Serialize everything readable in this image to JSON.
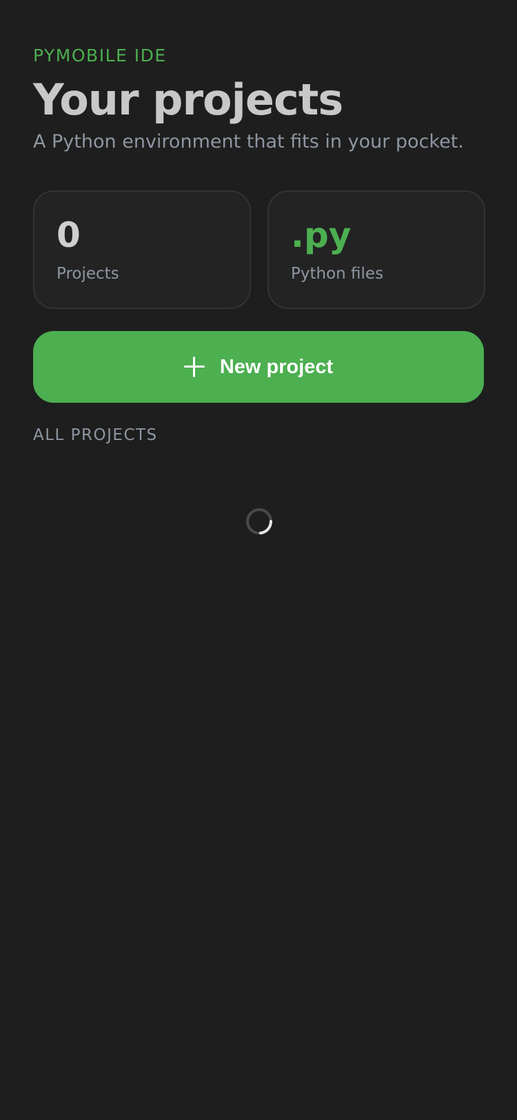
{
  "header": {
    "eyebrow": "PYMOBILE IDE",
    "title": "Your projects",
    "subtitle": "A Python environment that fits in your pocket."
  },
  "stats": [
    {
      "value": "0",
      "label": "Projects"
    },
    {
      "value": ".py",
      "label": "Python files"
    }
  ],
  "actions": {
    "new_project_label": "New project",
    "new_project_icon": "plus-icon"
  },
  "projects": {
    "section_label": "ALL PROJECTS",
    "loading": true
  },
  "colors": {
    "background": "#1e1e1e",
    "accent": "#4caf50",
    "card": "#232323",
    "muted_text": "#8e96a2"
  }
}
